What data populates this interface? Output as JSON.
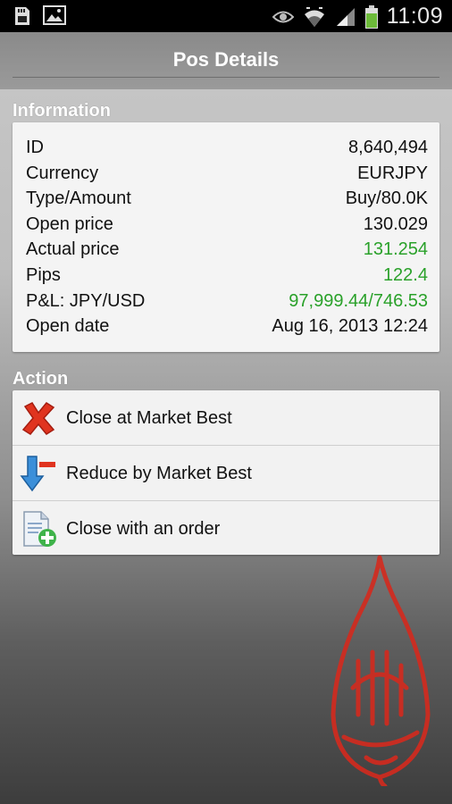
{
  "status_bar": {
    "time": "11:09"
  },
  "header": {
    "title": "Pos Details"
  },
  "information": {
    "label": "Information",
    "rows": [
      {
        "label": "ID",
        "value": "8,640,494"
      },
      {
        "label": "Currency",
        "value": "EURJPY"
      },
      {
        "label": "Type/Amount",
        "value": "Buy/80.0K"
      },
      {
        "label": "Open price",
        "value": "130.029"
      },
      {
        "label": "Actual price",
        "value": "131.254"
      },
      {
        "label": "Pips",
        "value": "122.4"
      },
      {
        "label": "P&L: JPY/USD",
        "value": "97,999.44/746.53"
      },
      {
        "label": "Open date",
        "value": "Aug 16, 2013 12:24"
      }
    ]
  },
  "action": {
    "label": "Action",
    "items": [
      {
        "label": "Close at Market Best",
        "icon": "red-x-icon"
      },
      {
        "label": "Reduce by Market Best",
        "icon": "reduce-arrow-icon"
      },
      {
        "label": "Close with an order",
        "icon": "document-add-icon"
      }
    ]
  },
  "colors": {
    "positive": "#2aa12a",
    "calligraphy": "#d42a1e"
  }
}
